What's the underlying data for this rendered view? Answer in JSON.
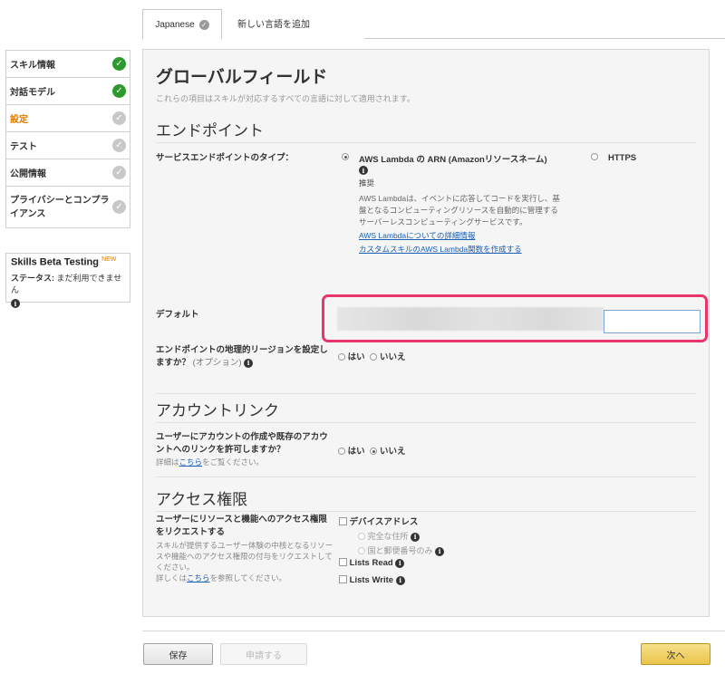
{
  "tabs": {
    "active_label": "Japanese",
    "add_label": "新しい言語を追加"
  },
  "sidebar": {
    "items": [
      {
        "label": "スキル情報",
        "status": "done"
      },
      {
        "label": "対話モデル",
        "status": "done"
      },
      {
        "label": "設定",
        "status": "todo",
        "active": true
      },
      {
        "label": "テスト",
        "status": "todo"
      },
      {
        "label": "公開情報",
        "status": "todo"
      },
      {
        "label": "プライバシーとコンプライアンス",
        "status": "todo"
      }
    ]
  },
  "beta": {
    "title": "Skills Beta Testing",
    "new_badge": "NEW",
    "status_label": "ステータス:",
    "status_value": "まだ利用できません"
  },
  "main": {
    "title": "グローバルフィールド",
    "subtitle": "これらの項目はスキルが対応するすべての言語に対して適用されます。",
    "endpoint": {
      "heading": "エンドポイント",
      "type_label": "サービスエンドポイントのタイプ：",
      "option_lambda": "AWS Lambda の ARN (Amazonリソースネーム)",
      "recommended": "推奨",
      "lambda_desc_1": "AWS Lambdaは、イベントに応答してコードを実行し、基",
      "lambda_desc_2": "盤となるコンピューティングリソースを自動的に管理する",
      "lambda_desc_3": "サーバーレスコンピューティングサービスです。",
      "link_details": "AWS Lambdaについての詳細情報",
      "link_create": "カスタムスキルのAWS Lambda関数を作成する",
      "option_https": "HTTPS",
      "default_label": "デフォルト",
      "region_label_1": "エンドポイントの地理的リージョンを設定し",
      "region_label_2": "ますか？",
      "region_optional": "(オプション)",
      "yes": "はい",
      "no": "いいえ"
    },
    "account_linking": {
      "heading": "アカウントリンク",
      "question_1": "ユーザーにアカウントの作成や既存のアカウ",
      "question_2": "ントへのリンクを許可しますか？",
      "detail_prefix": "詳細は",
      "detail_link": "こちら",
      "detail_suffix": "をご覧ください。",
      "yes": "はい",
      "no": "いいえ"
    },
    "permissions": {
      "heading": "アクセス権限",
      "question_1": "ユーザーにリソースと機能へのアクセス権限",
      "question_2": "をリクエストする",
      "desc_1": "スキルが提供するユーザー体験の中核となるリソー",
      "desc_2": "スや機能へのアクセス権限の付与をリクエストして",
      "desc_3": "ください。",
      "detail_prefix": "詳しくは",
      "detail_link": "こちら",
      "detail_suffix": "を参照してください。",
      "device_address": "デバイスアドレス",
      "full_address": "完全な住所",
      "country_postal": "国と郵便番号のみ",
      "lists_read": "Lists Read",
      "lists_write": "Lists Write"
    }
  },
  "footer": {
    "save": "保存",
    "submit": "申請する",
    "next": "次へ"
  },
  "colors": {
    "done": "#2c9a2c",
    "active_nav": "#e07b00",
    "highlight": "#e8366c",
    "link": "#1a5fb4"
  }
}
